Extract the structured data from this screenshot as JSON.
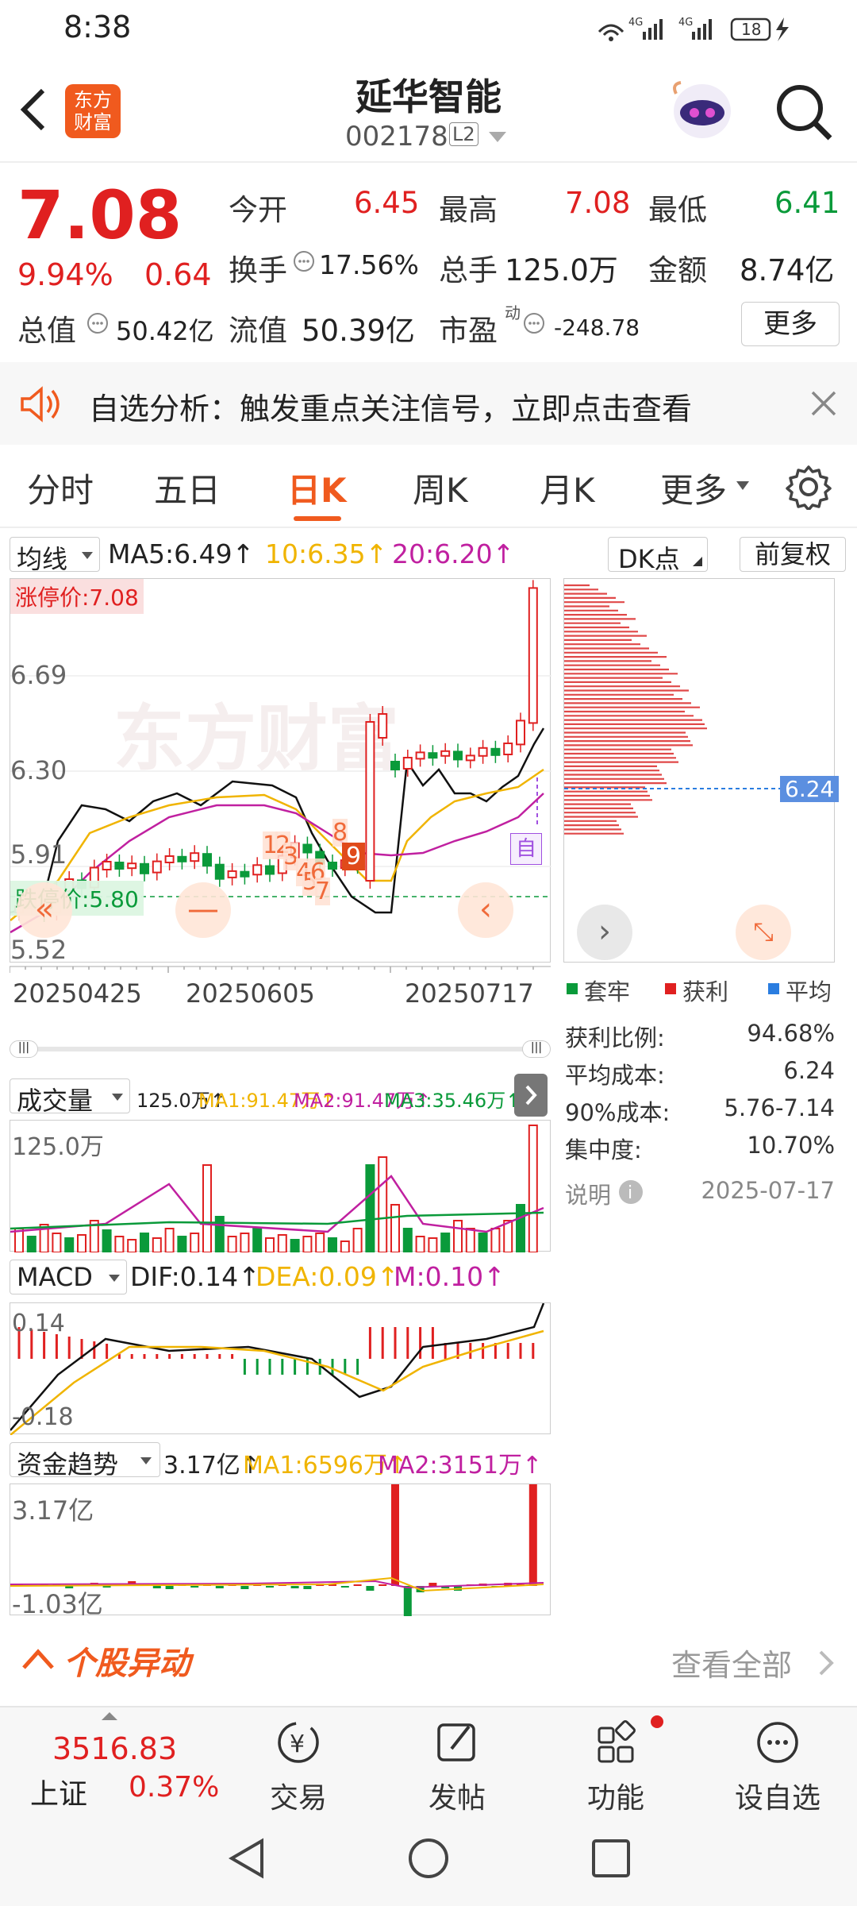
{
  "status": {
    "time": "8:38",
    "net1": "4G",
    "net2": "4G",
    "battery": "18"
  },
  "header": {
    "back": "back",
    "logo_line1": "东方",
    "logo_line2": "财富",
    "stock_name": "延华智能",
    "stock_code": "002178",
    "level": "L2"
  },
  "quote": {
    "price": "7.08",
    "pct": "9.94%",
    "chg": "0.64",
    "open_label": "今开",
    "open": "6.45",
    "high_label": "最高",
    "high": "7.08",
    "low_label": "最低",
    "low": "6.41",
    "turnover_label": "换手",
    "turnover": "17.56%",
    "vol_label": "总手",
    "vol": "125.0万",
    "amount_label": "金额",
    "amount": "8.74亿",
    "mktcap_label": "总值",
    "mktcap": "50.42亿",
    "float_label": "流值",
    "float": "50.39亿",
    "pe_label": "市盈",
    "pe_sup": "动",
    "pe": "-248.78",
    "more": "更多"
  },
  "banner": {
    "text": "自选分析：触发重点关注信号，立即点击查看"
  },
  "tabs": [
    "分时",
    "五日",
    "日K",
    "周K",
    "月K",
    "更多"
  ],
  "active_tab": "日K",
  "kline": {
    "ma_selector": "均线",
    "ma5": "MA5:6.49↑",
    "ma10": "10:6.35↑",
    "ma20": "20:6.20↑",
    "dk_btn": "DK点",
    "fq_btn": "前复权",
    "y_top": "7.08",
    "y1": "6.69",
    "y2": "6.30",
    "y3": "5.91",
    "y_bot": "5.52",
    "limit_up": "涨停价:7.08",
    "limit_down": "跌停价:5.80",
    "auto": "自",
    "dates": [
      "20250425",
      "20250605",
      "20250717"
    ],
    "signals": [
      "1",
      "2",
      "3",
      "4",
      "5",
      "6",
      "7",
      "8",
      "9"
    ]
  },
  "chip": {
    "price_tag": "6.24",
    "legend": [
      "套牢",
      "获利",
      "平均"
    ],
    "rows": [
      {
        "k": "获利比例:",
        "v": "94.68%"
      },
      {
        "k": "平均成本:",
        "v": "6.24"
      },
      {
        "k": "90%成本:",
        "v": "5.76-7.14"
      },
      {
        "k": "集中度:",
        "v": "10.70%"
      }
    ],
    "note": "说明",
    "date": "2025-07-17"
  },
  "volume": {
    "selector": "成交量",
    "v": "125.0万↑",
    "ma1": "MA1:91.47万↑",
    "ma2": "MA2:91.47万↑",
    "ma3": "MA3:35.46万↑",
    "y_top": "125.0万"
  },
  "macd": {
    "selector": "MACD",
    "dif": "DIF:0.14↑",
    "dea": "DEA:0.09↑",
    "m": "M:0.10↑",
    "y_top": "0.14",
    "y_bot": "-0.18"
  },
  "fund": {
    "selector": "资金趋势",
    "v": "3.17亿↑",
    "ma1": "MA1:6596万↑",
    "ma2": "MA2:3151万↑",
    "y_top": "3.17亿",
    "y_bot": "-1.03亿"
  },
  "movement": {
    "title": "个股异动",
    "all": "查看全部"
  },
  "nav": {
    "index_value": "3516.83",
    "index_name": "上证",
    "index_pct": "0.37%",
    "items": [
      "交易",
      "发帖",
      "功能",
      "设自选"
    ]
  },
  "colors": {
    "up": "#e02020",
    "down": "#0a9a3a",
    "accent": "#f05a1e",
    "ma10": "#f0b400",
    "ma20": "#c020a0"
  }
}
